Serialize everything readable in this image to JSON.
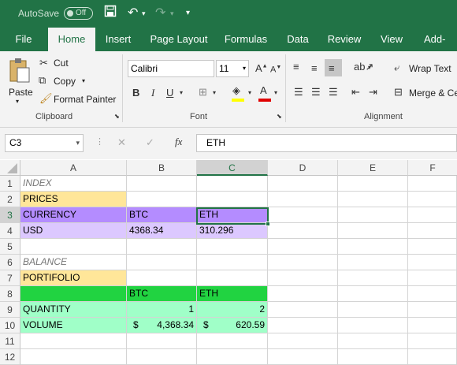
{
  "titlebar": {
    "autosave": "AutoSave",
    "toggle": "Off"
  },
  "ribbon_tabs": [
    "File",
    "Home",
    "Insert",
    "Page Layout",
    "Formulas",
    "Data",
    "Review",
    "View",
    "Add-ins"
  ],
  "clipboard": {
    "paste": "Paste",
    "cut": "Cut",
    "copy": "Copy",
    "format_painter": "Format Painter",
    "label": "Clipboard"
  },
  "font": {
    "name": "Calibri",
    "size": "11",
    "label": "Font"
  },
  "alignment": {
    "wrap_text": "Wrap Text",
    "merge": "Merge & Ce",
    "label": "Alignment"
  },
  "formula_bar": {
    "name_box": "C3",
    "fx": "fx",
    "content": "ETH"
  },
  "columns": [
    "A",
    "B",
    "C",
    "D",
    "E",
    "F"
  ],
  "rows": [
    "1",
    "2",
    "3",
    "4",
    "5",
    "6",
    "7",
    "8",
    "9",
    "10",
    "11",
    "12"
  ],
  "cells": {
    "A1": "INDEX",
    "A2": "PRICES",
    "A3": "CURRENCY",
    "B3": "BTC",
    "C3": "ETH",
    "A4": "USD",
    "B4": "4368.34",
    "C4": "310.296",
    "A6": "BALANCE",
    "A7": "PORTIFOLIO",
    "B8": "BTC",
    "C8": "ETH",
    "A9": "QUANTITY",
    "B9": "1",
    "C9": "2",
    "A10": "VOLUME",
    "B10_sym": "$",
    "B10_val": "4,368.34",
    "C10_sym": "$",
    "C10_val": "620.59"
  },
  "colors": {
    "excel_green": "#217346",
    "prices_fill": "#ffe699",
    "currency_fill": "#b48cff",
    "usd_fill": "#dcc8ff",
    "header_green": "#21d341",
    "data_green": "#a0ffc8"
  }
}
